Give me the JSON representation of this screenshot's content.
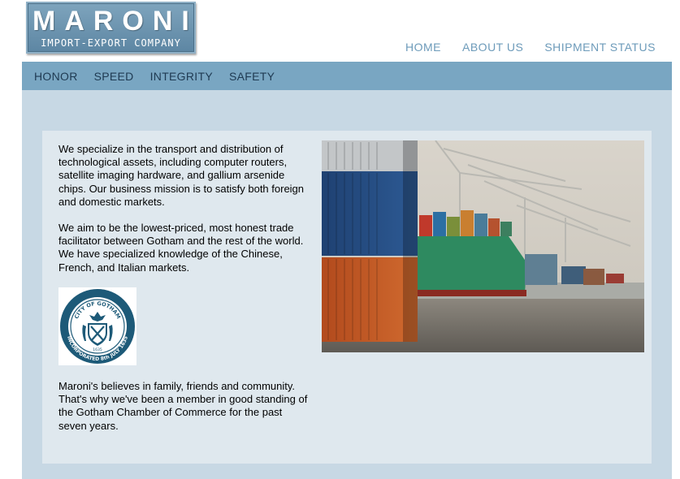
{
  "logo": {
    "title": "MARONI",
    "subtitle": "IMPORT-EXPORT COMPANY"
  },
  "top_nav": [
    "HOME",
    "ABOUT US",
    "SHIPMENT STATUS"
  ],
  "sub_nav": [
    "HONOR",
    "SPEED",
    "INTEGRITY",
    "SAFETY"
  ],
  "content": {
    "paragraph1": "We specialize in the transport and distribution of technological assets, including computer routers, satellite imaging hardware, and gallium arsenide chips. Our business mission is to satisfy both foreign and domestic markets.",
    "paragraph2": "We aim to be the lowest-priced, most honest trade facilitator between Gotham and the rest of the world. We have specialized knowledge of the Chinese, French, and Italian markets.",
    "paragraph3": "Maroni's believes in family, friends and community. That's why we've been a member in good standing of the Gotham Chamber of Commerce for the past seven years."
  },
  "seal": {
    "top_text": "CITY OF GOTHAM",
    "bottom_text": "INCORPORATED 8th JULY 1635",
    "year": "1635"
  },
  "colors": {
    "brand": "#6d9bba",
    "bar": "#79a6c2",
    "background": "#c7d8e4",
    "panel": "#dfe8ee",
    "seal": "#1d5a78"
  }
}
